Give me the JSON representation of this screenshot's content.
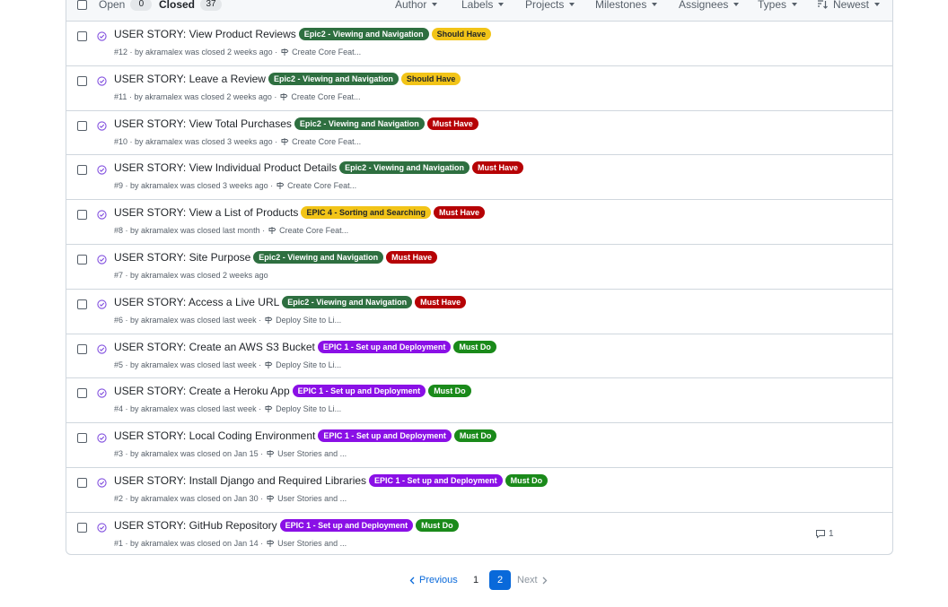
{
  "header": {
    "open_label": "Open",
    "open_count": "0",
    "closed_label": "Closed",
    "closed_count": "37",
    "filters": [
      "Author",
      "Labels",
      "Projects",
      "Milestones",
      "Assignees",
      "Types"
    ],
    "sort_label": "Newest"
  },
  "label_colors": {
    "Epic2 - Viewing and Navigation": {
      "bg": "#2e6f40",
      "fg": "#ffffff"
    },
    "EPIC 4 - Sorting and Searching": {
      "bg": "#f2c418",
      "fg": "#1f2328"
    },
    "EPIC 1 - Set up and Deployment": {
      "bg": "#8a10e6",
      "fg": "#ffffff"
    },
    "Should Have": {
      "bg": "#f2c418",
      "fg": "#1f2328"
    },
    "Must Have": {
      "bg": "#b60205",
      "fg": "#ffffff"
    },
    "Must Do": {
      "bg": "#1a8a1a",
      "fg": "#ffffff"
    }
  },
  "issues": [
    {
      "title": "USER STORY: View Product Reviews",
      "labels": [
        "Epic2 - Viewing and Navigation",
        "Should Have"
      ],
      "meta": "#12 · by akramalex was closed 2 weeks ago ·",
      "milestone": "Create Core Feat..."
    },
    {
      "title": "USER STORY: Leave a Review",
      "labels": [
        "Epic2 - Viewing and Navigation",
        "Should Have"
      ],
      "meta": "#11 · by akramalex was closed 2 weeks ago ·",
      "milestone": "Create Core Feat..."
    },
    {
      "title": "USER STORY: View Total Purchases",
      "labels": [
        "Epic2 - Viewing and Navigation",
        "Must Have"
      ],
      "meta": "#10 · by akramalex was closed 3 weeks ago ·",
      "milestone": "Create Core Feat..."
    },
    {
      "title": "USER STORY: View Individual Product Details",
      "labels": [
        "Epic2 - Viewing and Navigation",
        "Must Have"
      ],
      "meta": "#9 · by akramalex was closed 3 weeks ago ·",
      "milestone": "Create Core Feat..."
    },
    {
      "title": "USER STORY: View a List of Products",
      "labels": [
        "EPIC 4 - Sorting and Searching",
        "Must Have"
      ],
      "meta": "#8 · by akramalex was closed last month ·",
      "milestone": "Create Core Feat..."
    },
    {
      "title": "USER STORY: Site Purpose",
      "labels": [
        "Epic2 - Viewing and Navigation",
        "Must Have"
      ],
      "meta": "#7 · by akramalex was closed 2 weeks ago",
      "milestone": ""
    },
    {
      "title": "USER STORY: Access a Live URL",
      "labels": [
        "Epic2 - Viewing and Navigation",
        "Must Have"
      ],
      "meta": "#6 · by akramalex was closed last week ·",
      "milestone": "Deploy Site to Li..."
    },
    {
      "title": "USER STORY: Create an AWS S3 Bucket",
      "labels": [
        "EPIC 1 - Set up and Deployment",
        "Must Do"
      ],
      "meta": "#5 · by akramalex was closed last week ·",
      "milestone": "Deploy Site to Li..."
    },
    {
      "title": "USER STORY: Create a Heroku App",
      "labels": [
        "EPIC 1 - Set up and Deployment",
        "Must Do"
      ],
      "meta": "#4 · by akramalex was closed last week ·",
      "milestone": "Deploy Site to Li..."
    },
    {
      "title": "USER STORY: Local Coding Environment",
      "labels": [
        "EPIC 1 - Set up and Deployment",
        "Must Do"
      ],
      "meta": "#3 · by akramalex was closed on Jan 15 ·",
      "milestone": "User Stories and ..."
    },
    {
      "title": "USER STORY: Install Django and Required Libraries",
      "labels": [
        "EPIC 1 - Set up and Deployment",
        "Must Do"
      ],
      "meta": "#2 · by akramalex was closed on Jan 30 ·",
      "milestone": "User Stories and ..."
    },
    {
      "title": "USER STORY: GitHub Repository",
      "labels": [
        "EPIC 1 - Set up and Deployment",
        "Must Do"
      ],
      "meta": "#1 · by akramalex was closed on Jan 14 ·",
      "milestone": "User Stories and ...",
      "comments": "1"
    }
  ],
  "pagination": {
    "previous_label": "Previous",
    "pages": [
      "1",
      "2"
    ],
    "current_page": "2",
    "next_label": "Next"
  }
}
